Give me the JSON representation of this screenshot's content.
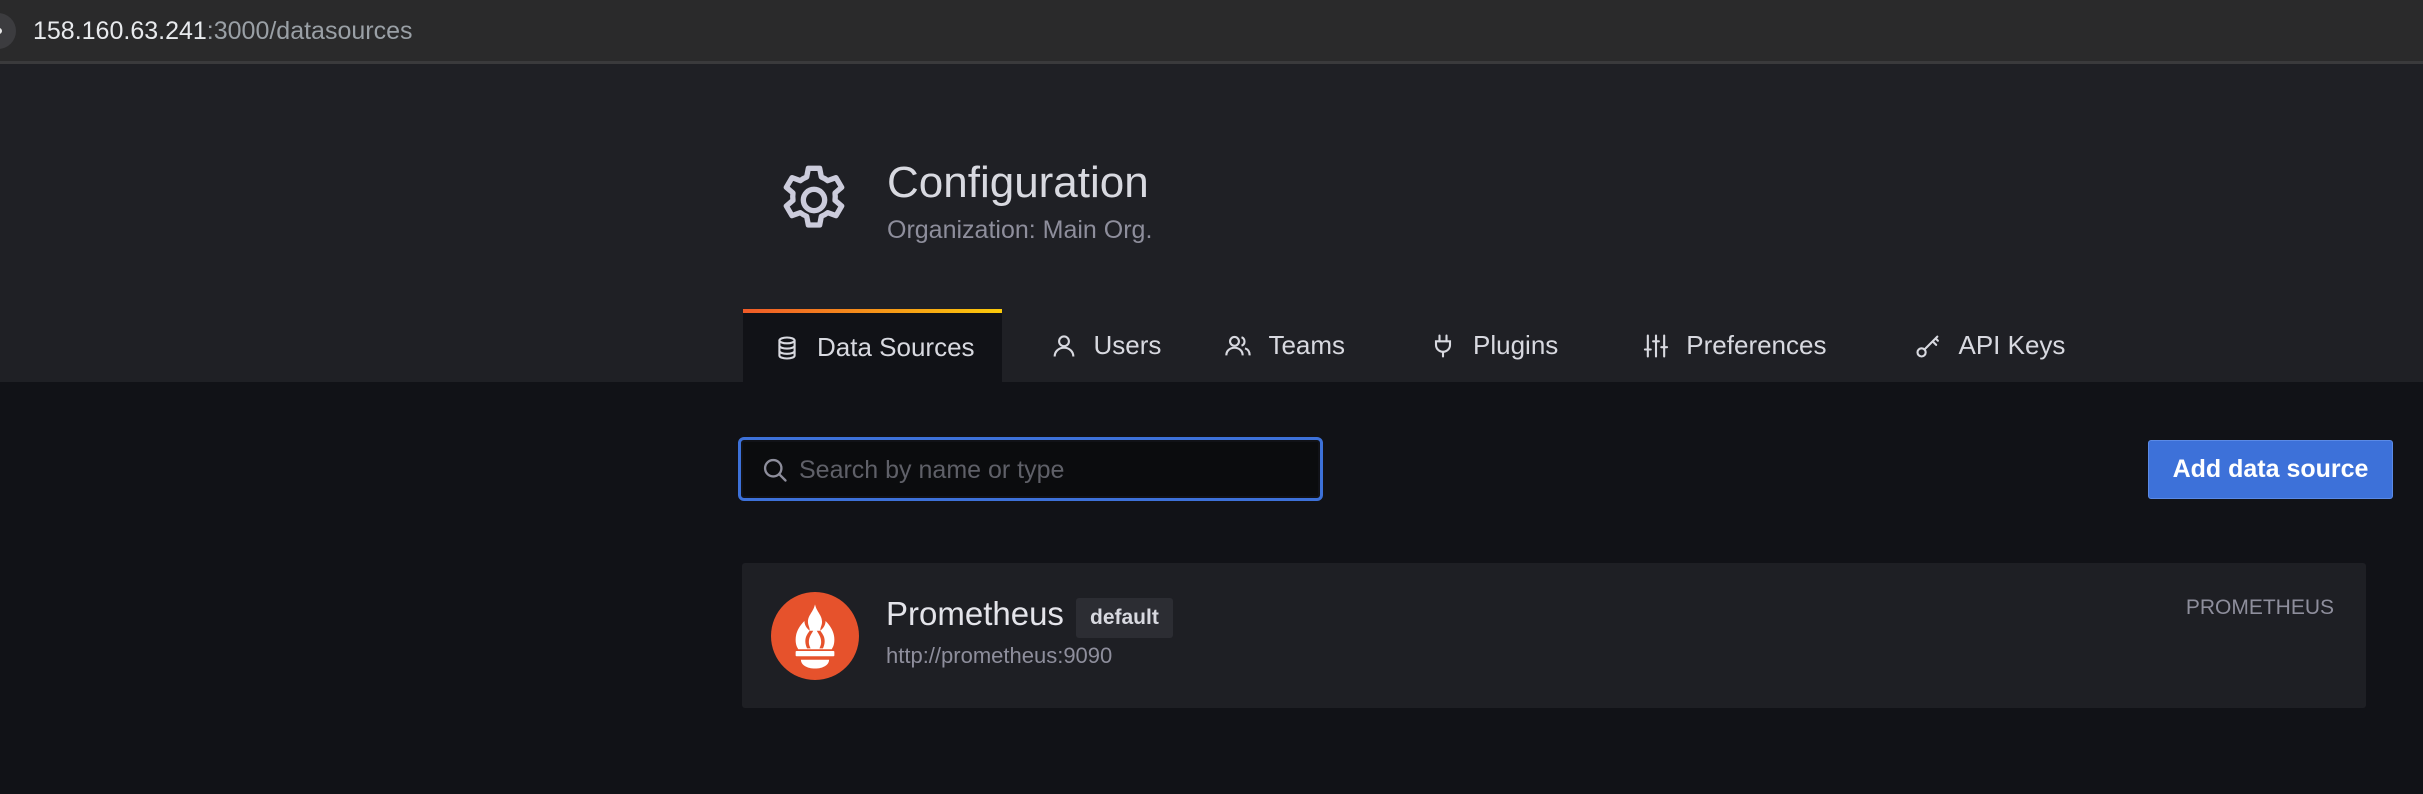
{
  "browser": {
    "url_host": "158.160.63.241",
    "url_rest": ":3000/datasources"
  },
  "header": {
    "title": "Configuration",
    "subtitle": "Organization: Main Org.",
    "icon": "gear-icon"
  },
  "tabs": [
    {
      "label": "Data Sources",
      "icon": "database-icon",
      "active": true
    },
    {
      "label": "Users",
      "icon": "user-icon"
    },
    {
      "label": "Teams",
      "icon": "users-icon"
    },
    {
      "label": "Plugins",
      "icon": "plug-icon"
    },
    {
      "label": "Preferences",
      "icon": "sliders-icon"
    },
    {
      "label": "API Keys",
      "icon": "key-icon"
    }
  ],
  "search": {
    "placeholder": "Search by name or type",
    "value": ""
  },
  "actions": {
    "add_label": "Add data source"
  },
  "datasources": [
    {
      "name": "Prometheus",
      "badge": "default",
      "url": "http://prometheus:9090",
      "type": "PROMETHEUS",
      "logo": "prometheus-logo-icon"
    }
  ],
  "colors": {
    "accent_blue": "#3d71d9",
    "tab_gradient_start": "#f05a28",
    "tab_gradient_end": "#fbca0a",
    "prometheus_orange": "#e6522c"
  }
}
